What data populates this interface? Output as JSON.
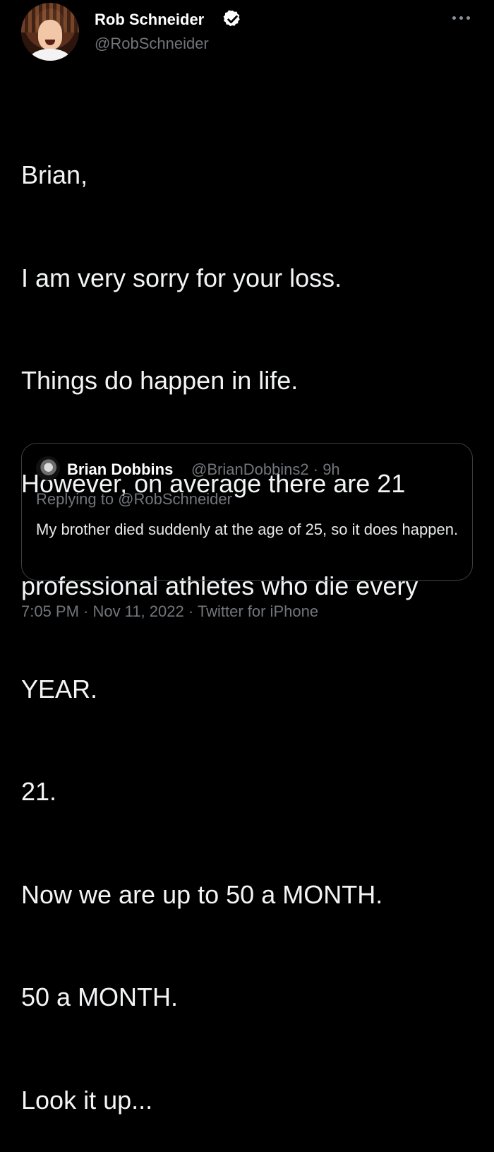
{
  "tweet": {
    "author": {
      "display_name": "Rob Schneider",
      "handle": "@RobSchneider",
      "verified": true,
      "avatar_icon": "profile-photo"
    },
    "text_lines": [
      "Brian,",
      "I am very sorry for your loss.",
      "Things do happen in life.",
      "However, on average there are 21",
      "professional athletes who die every",
      "YEAR.",
      "21.",
      "Now we are up to 50 a MONTH.",
      "50 a MONTH.",
      "Look it up..."
    ],
    "more_icon": "ellipsis-icon",
    "timestamp": "7:05 PM · Nov 11, 2022 · Twitter for iPhone"
  },
  "quoted_tweet": {
    "author_name": "Brian Dobbins",
    "handle_time": "@BrianDobbins2 · 9h",
    "replying_to": "Replying to @RobSchneider",
    "text": "My brother died suddenly at the age of 25,  so it does happen.",
    "avatar_icon": "profile-photo"
  },
  "colors": {
    "background": "#000000",
    "primary_text": "#e7e9ea",
    "secondary_text": "#71767b",
    "verified_badge": "#ffffff"
  }
}
